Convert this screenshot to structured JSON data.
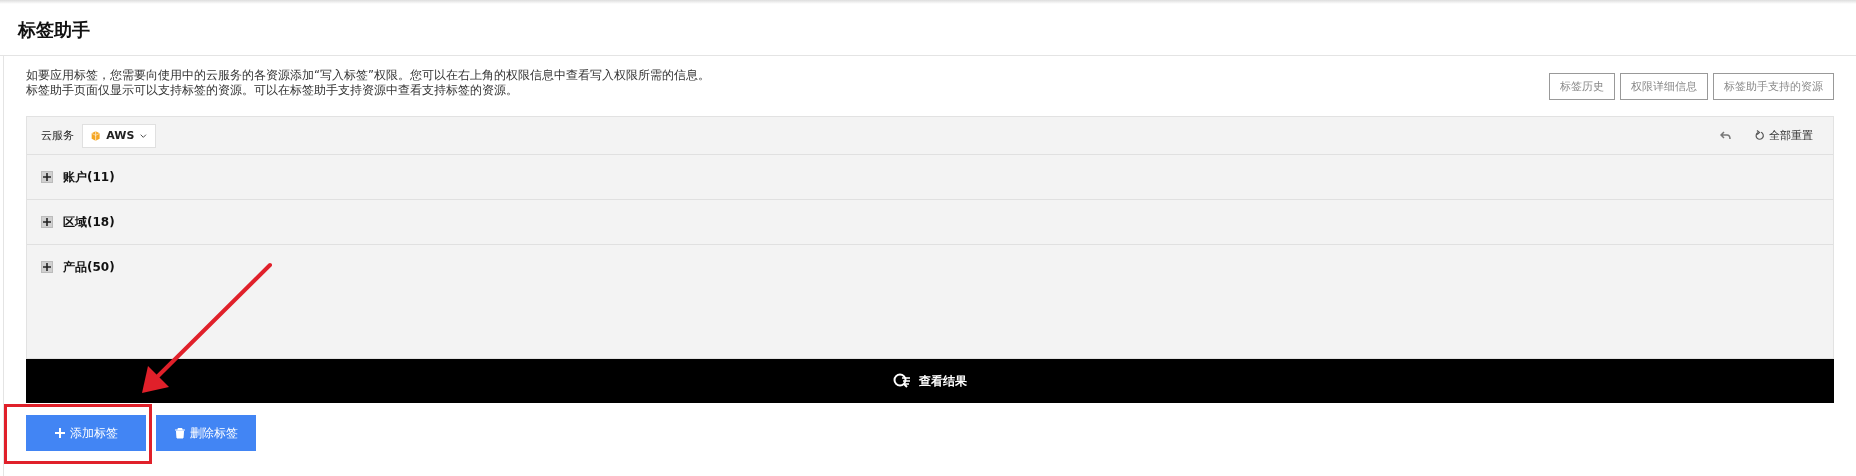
{
  "page_title": "标签助手",
  "description": [
    "如要应用标签，您需要向使用中的云服务的各资源添加“写入标签”权限。您可以在右上角的权限信息中查看写入权限所需的信息。",
    "标签助手页面仅显示可以支持标签的资源。可以在标签助手支持资源中查看支持标签的资源。"
  ],
  "top_buttons": [
    "标签历史",
    "权限详细信息",
    "标签助手支持的资源"
  ],
  "filter": {
    "label": "云服务",
    "service": "AWS",
    "reset_all": "全部重置"
  },
  "groups": [
    {
      "label": "账户(11)",
      "expanded": false
    },
    {
      "label": "区域(18)",
      "expanded": false
    },
    {
      "label": "产品(50)",
      "expanded": false
    }
  ],
  "results_button": "查看结果",
  "actions": [
    {
      "label": "添加标签",
      "kind": "add",
      "highlighted": true
    },
    {
      "label": "删除标签",
      "kind": "delete",
      "highlighted": false
    }
  ]
}
